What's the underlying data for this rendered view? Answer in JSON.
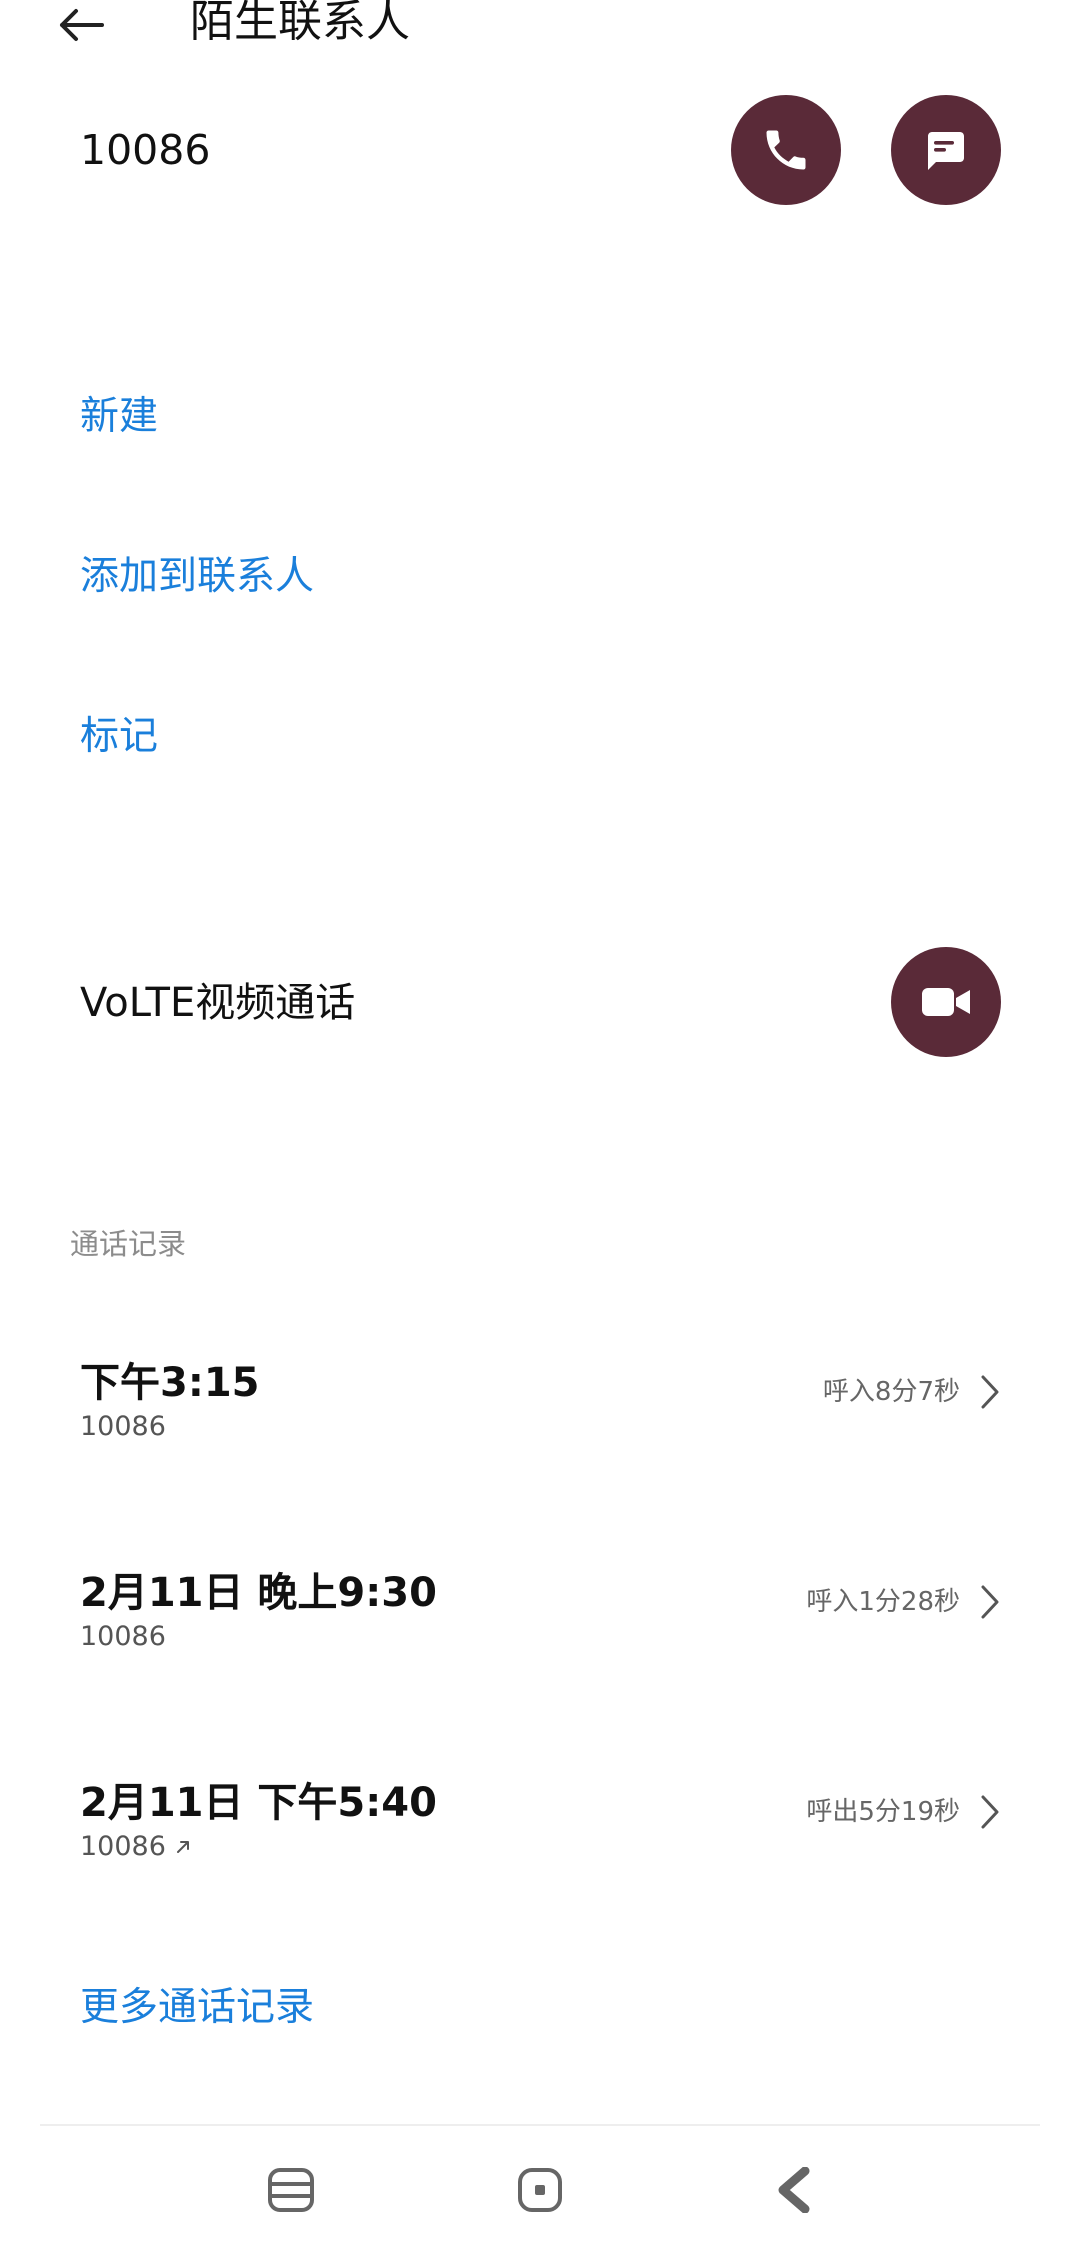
{
  "header": {
    "title": "陌生联系人",
    "back_icon": "arrow-left-icon"
  },
  "contact": {
    "number": "10086",
    "actions": [
      {
        "name": "call",
        "icon": "phone-icon"
      },
      {
        "name": "message",
        "icon": "message-icon"
      }
    ]
  },
  "options": {
    "new": "新建",
    "add_to_contacts": "添加到联系人",
    "mark": "标记"
  },
  "volte": {
    "label": "VoLTE视频通话",
    "icon": "video-camera-icon"
  },
  "call_log": {
    "section_title": "通话记录",
    "entries": [
      {
        "time": "下午3:15",
        "number": "10086",
        "detail": "呼入8分7秒",
        "outgoing": false
      },
      {
        "time": "2月11日 晚上9:30",
        "number": "10086",
        "detail": "呼入1分28秒",
        "outgoing": false
      },
      {
        "time": "2月11日 下午5:40",
        "number": "10086",
        "detail": "呼出5分19秒",
        "outgoing": true
      }
    ],
    "more_label": "更多通话记录"
  },
  "colors": {
    "accent_link": "#1a7fdb",
    "action_button": "#5a2a38",
    "background": "#ffffff"
  },
  "nav_bar": {
    "icons": [
      "menu-icon",
      "home-icon",
      "back-icon"
    ]
  }
}
